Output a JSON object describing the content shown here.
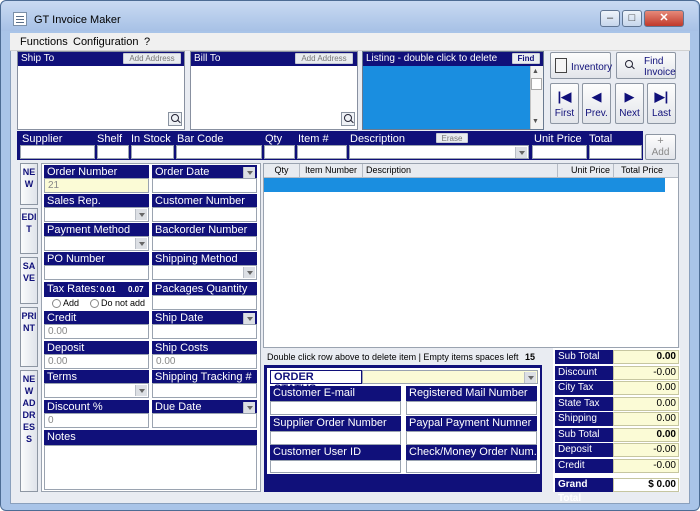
{
  "window": {
    "title": "GT Invoice Maker",
    "minimize": "–",
    "maximize": "□",
    "close": "✕"
  },
  "menu": [
    "Functions",
    "Configuration",
    "?"
  ],
  "ship_to": {
    "label": "Ship To",
    "add": "Add Address"
  },
  "bill_to": {
    "label": "Bill To",
    "add": "Add Address"
  },
  "listing": {
    "label": "Listing - double click to delete",
    "find": "Find"
  },
  "toolbar": {
    "inventory": "Inventory",
    "find_invoice": "Find\nInvoice",
    "first": "First",
    "prev": "Prev.",
    "next": "Next",
    "last": "Last"
  },
  "entry": {
    "supplier": "Supplier",
    "shelf": "Shelf",
    "in_stock": "In Stock",
    "bar_code": "Bar Code",
    "qty": "Qty",
    "item": "Item #",
    "description": "Description",
    "erase": "Erase",
    "unit_price": "Unit Price",
    "total": "Total",
    "add": "Add"
  },
  "side_buttons": [
    "NEW",
    "EDIT",
    "SAVE",
    "PRINT",
    "NEW ADDRESS"
  ],
  "form": {
    "order_number": "Order Number",
    "order_number_value": "21",
    "order_date": "Order Date",
    "sales_rep": "Sales Rep.",
    "customer_number": "Customer Number",
    "payment_method": "Payment Method",
    "backorder_number": "Backorder Number",
    "po_number": "PO Number",
    "shipping_method": "Shipping Method",
    "tax_rates": "Tax Rates:",
    "tax1": "0.01",
    "tax2": "0.07",
    "add": "Add",
    "do_not_add": "Do not add",
    "packages_quantity": "Packages Quantity",
    "credit": "Credit",
    "credit_value": "0.00",
    "ship_date": "Ship Date",
    "deposit": "Deposit",
    "deposit_value": "0.00",
    "ship_costs": "Ship Costs",
    "ship_costs_value": "0.00",
    "terms": "Terms",
    "shipping_tracking": "Shipping Tracking  #",
    "discount": "Discount %",
    "discount_value": "0",
    "due_date": "Due Date",
    "notes": "Notes"
  },
  "items_table": {
    "columns": [
      "Qty",
      "Item Number",
      "Description",
      "Unit Price",
      "Total Price"
    ]
  },
  "items_info": {
    "text": "Double click row above to delete item  |  Empty items spaces left",
    "count": "15"
  },
  "order_status": {
    "label": "ORDER STATUS:",
    "customer_email": "Customer E-mail",
    "registered_mail": "Registered Mail Number",
    "supplier_order": "Supplier Order Number",
    "paypal": "Paypal Payment Numner",
    "customer_user_id": "Customer User ID",
    "check_money": "Check/Money Order Num."
  },
  "totals": [
    {
      "label": "Sub Total",
      "value": "0.00",
      "bold": true
    },
    {
      "label": "Discount",
      "value": "-0.00",
      "bold": false
    },
    {
      "label": "City Tax",
      "value": "0.00",
      "bold": false
    },
    {
      "label": "State Tax",
      "value": "0.00",
      "bold": false
    },
    {
      "label": "Shipping",
      "value": "0.00",
      "bold": false
    },
    {
      "label": "Sub Total",
      "value": "0.00",
      "bold": true
    },
    {
      "label": "Deposit",
      "value": "-0.00",
      "bold": false
    },
    {
      "label": "Credit",
      "value": "-0.00",
      "bold": false
    }
  ],
  "grand_total": {
    "label": "Grand Total",
    "value": "$ 0.00"
  }
}
